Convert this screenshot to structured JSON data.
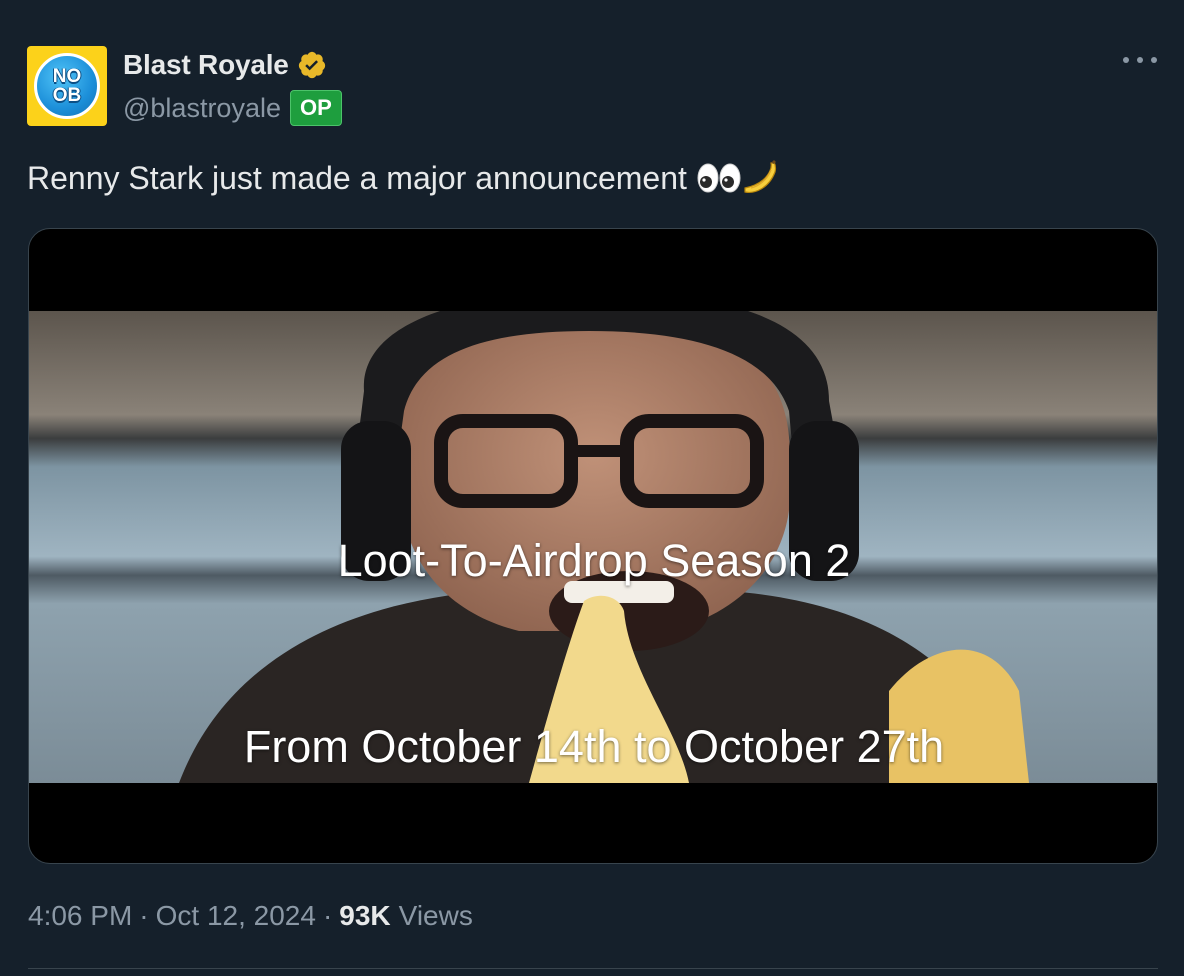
{
  "author": {
    "display_name": "Blast Royale",
    "handle": "@blastroyale",
    "badge": "OP",
    "avatar_text_line1": "NO",
    "avatar_text_line2": "OB",
    "verified_icon": "verified-badge-icon"
  },
  "tweet": {
    "text": "Renny Stark just made a major announcement",
    "emoji": [
      "eyes-emoji",
      "banana-emoji"
    ]
  },
  "media": {
    "caption_line1": "Loot-To-Airdrop Season 2",
    "caption_line2": "From October 14th to October 27th"
  },
  "meta": {
    "time": "4:06 PM",
    "date": "Oct 12, 2024",
    "views_count": "93K",
    "views_label": "Views",
    "separator": "·"
  },
  "colors": {
    "background": "#15202b",
    "verified_gold": "#e8b829",
    "op_badge": "#1e9e3e",
    "secondary_text": "#8b98a5"
  }
}
